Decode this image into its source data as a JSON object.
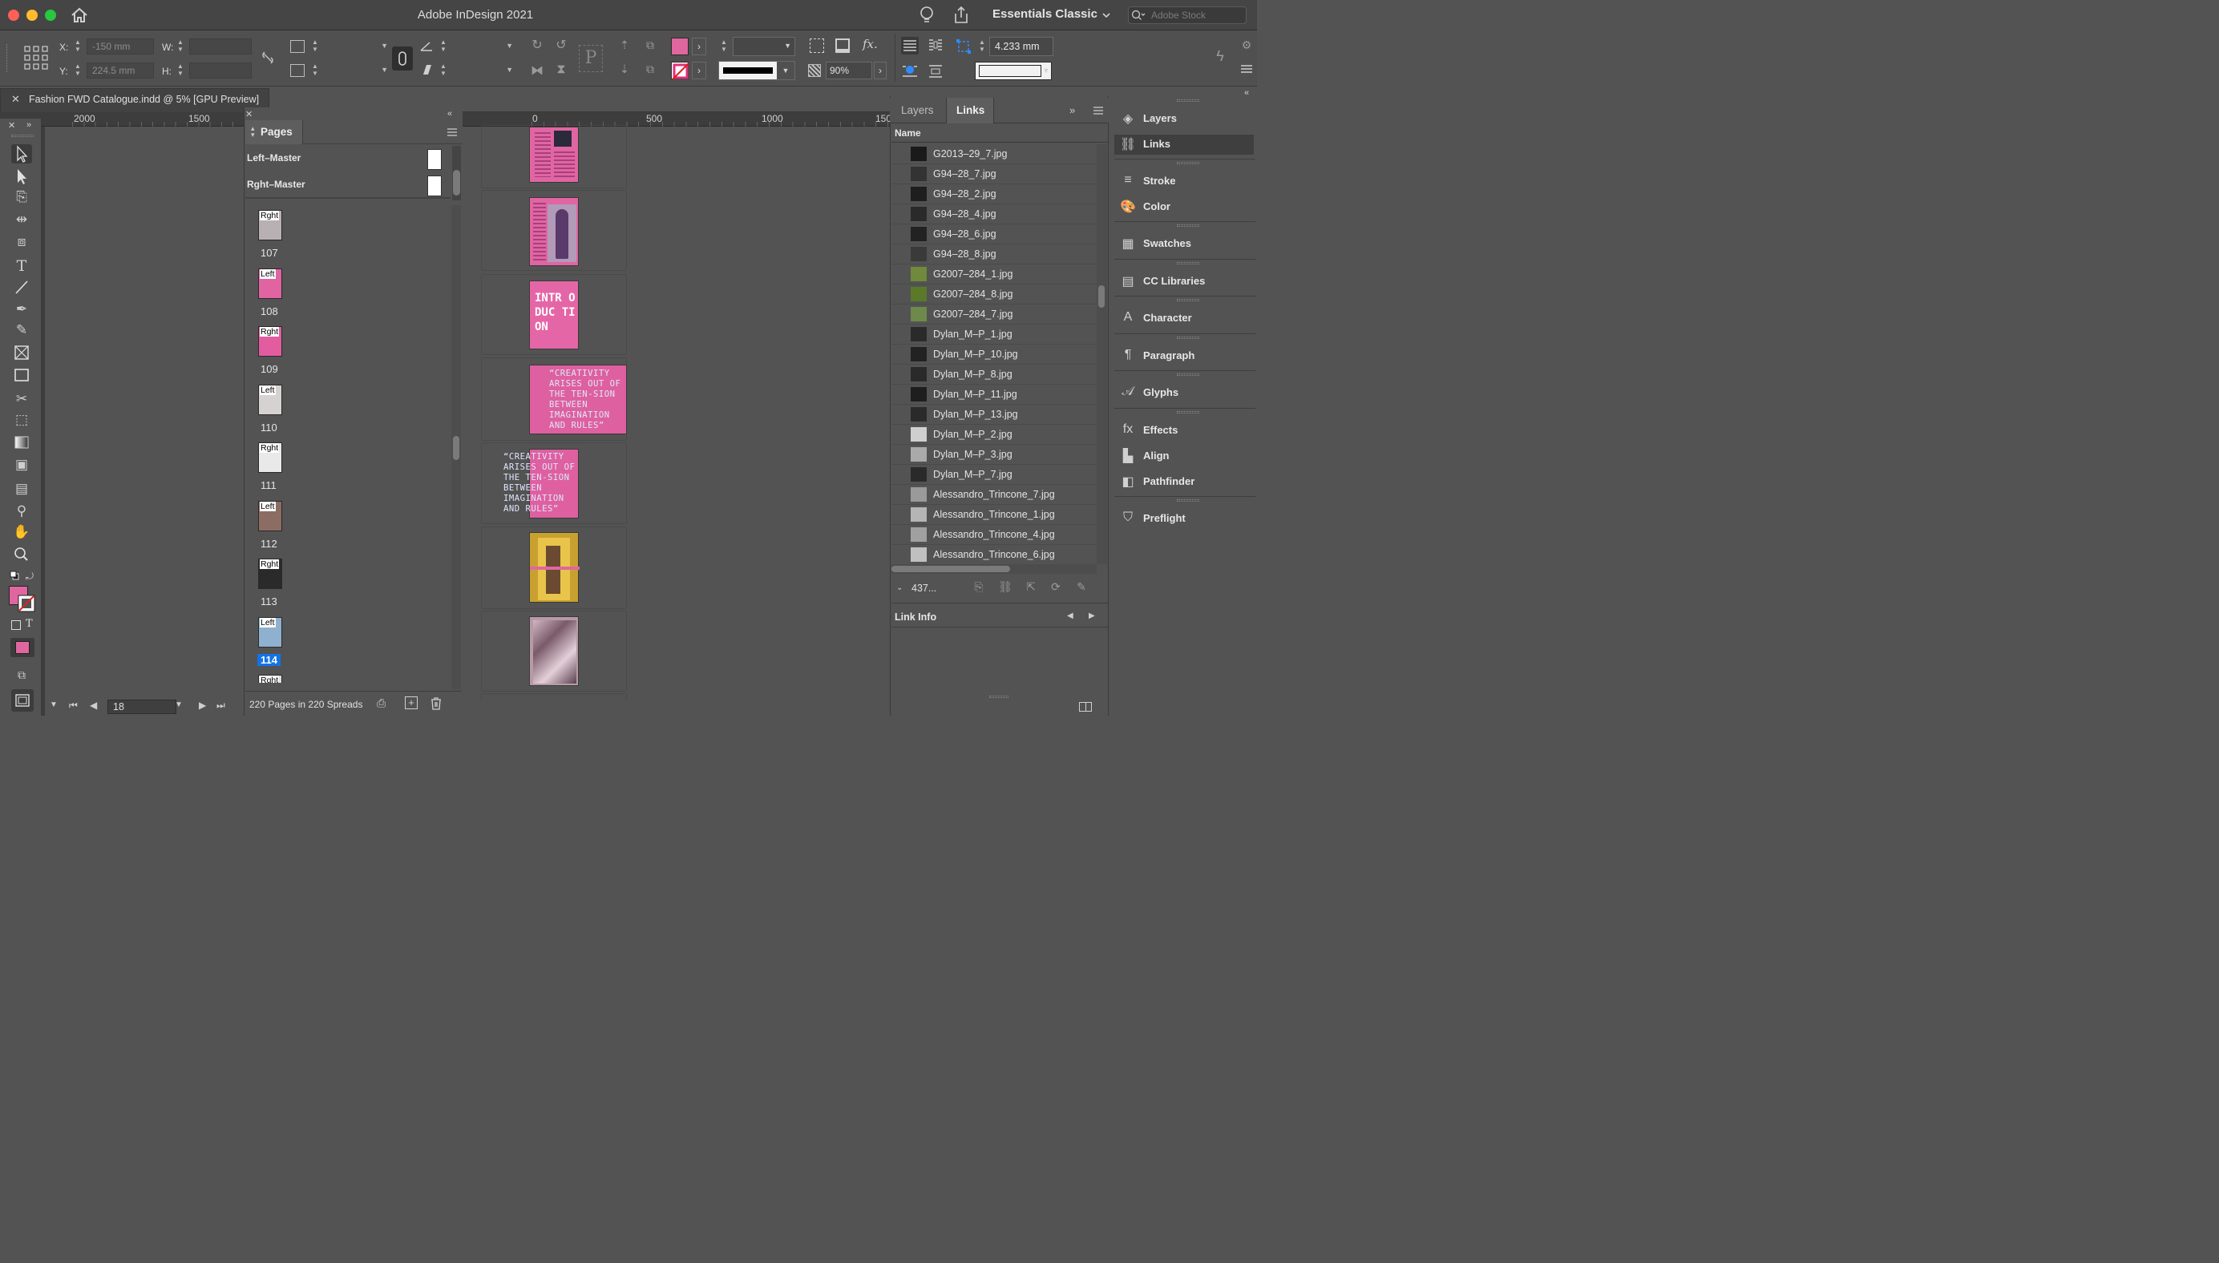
{
  "window": {
    "title": "Adobe InDesign 2021",
    "workspace": "Essentials Classic",
    "stock_placeholder": "Adobe Stock"
  },
  "control": {
    "x_label": "X:",
    "x_value": "-150 mm",
    "y_label": "Y:",
    "y_value": "224.5 mm",
    "w_label": "W:",
    "h_label": "H:",
    "fill_color": "#e066a0",
    "opacity": "90%",
    "stroke_weight": "4.233 mm"
  },
  "document": {
    "tab_title": "Fashion FWD Catalogue.indd @ 5% [GPU Preview]"
  },
  "ruler": {
    "left_labels": [
      "2000",
      "1500"
    ],
    "right_labels": [
      "0",
      "500",
      "1000",
      "150"
    ]
  },
  "pages_panel": {
    "title": "Pages",
    "masters": [
      {
        "name": "Left–Master"
      },
      {
        "name": "Rght–Master"
      }
    ],
    "pages": [
      {
        "prefix": "Rght",
        "number": "107",
        "color": "#b9b0b4",
        "selected": false
      },
      {
        "prefix": "Left",
        "number": "108",
        "color": "#e063a2",
        "selected": false
      },
      {
        "prefix": "Rght",
        "number": "109",
        "color": "#e35c9f",
        "selected": false
      },
      {
        "prefix": "Left",
        "number": "110",
        "color": "#d7d2d2",
        "selected": false
      },
      {
        "prefix": "Rght",
        "number": "111",
        "color": "#e9e9e9",
        "selected": false
      },
      {
        "prefix": "Left",
        "number": "112",
        "color": "#8c6d63",
        "selected": false
      },
      {
        "prefix": "Rght",
        "number": "113",
        "color": "#2a2a2a",
        "selected": false
      },
      {
        "prefix": "Left",
        "number": "114",
        "color": "#8fb0cf",
        "selected": true
      },
      {
        "prefix": "Rght",
        "number": "",
        "color": "#dddddd",
        "selected": false
      }
    ],
    "status": "220 Pages in 220 Spreads"
  },
  "canvas_text": {
    "quote": "“CREATIVITY ARISES OUT OF THE TEN-SION BETWEEN IMAGINATION AND RULES”",
    "intro": "INTR ODUC TION"
  },
  "links_panel": {
    "tabs": [
      "Layers",
      "Links"
    ],
    "active_tab": "Links",
    "column": "Name",
    "items": [
      "G2013–29_7.jpg",
      "G94–28_7.jpg",
      "G94–28_2.jpg",
      "G94–28_4.jpg",
      "G94–28_6.jpg",
      "G94–28_8.jpg",
      "G2007–284_1.jpg",
      "G2007–284_8.jpg",
      "G2007–284_7.jpg",
      "Dylan_M–P_1.jpg",
      "Dylan_M–P_10.jpg",
      "Dylan_M–P_8.jpg",
      "Dylan_M–P_11.jpg",
      "Dylan_M–P_13.jpg",
      "Dylan_M–P_2.jpg",
      "Dylan_M–P_3.jpg",
      "Dylan_M–P_7.jpg",
      "Alessandro_Trincone_7.jpg",
      "Alessandro_Trincone_1.jpg",
      "Alessandro_Trincone_4.jpg",
      "Alessandro_Trincone_6.jpg"
    ],
    "count": "437...",
    "link_info": "Link Info"
  },
  "dock": {
    "items": [
      "Layers",
      "Links",
      "Stroke",
      "Color",
      "Swatches",
      "CC Libraries",
      "Character",
      "Paragraph",
      "Glyphs",
      "Effects",
      "Align",
      "Pathfinder",
      "Preflight"
    ],
    "active": "Links"
  },
  "bottom": {
    "page_field": "18"
  }
}
